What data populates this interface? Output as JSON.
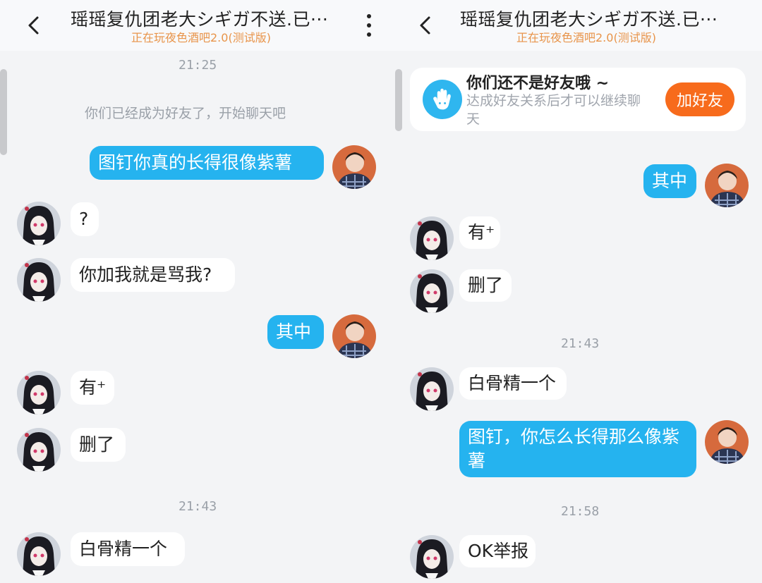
{
  "left": {
    "title": "瑶瑶复仇团老大シギガ不送.已···",
    "subtitle": "正在玩夜色酒吧2.0(测试版)",
    "time1": "21:25",
    "system": "你们已经成为好友了，开始聊天吧",
    "messages": [
      "图钉你真的长得很像紫薯",
      "?",
      "你加我就是骂我?",
      "其中",
      "有⁺",
      "删了",
      "白骨精一个"
    ],
    "time2": "21:43"
  },
  "right": {
    "title": "瑶瑶复仇团老大シギガ不送.已···",
    "subtitle": "正在玩夜色酒吧2.0(测试版)",
    "banner": {
      "title": "你们还不是好友哦 ~",
      "desc": "达成好友关系后才可以继续聊天",
      "button": "加好友"
    },
    "messages": [
      "其中",
      "有⁺",
      "删了",
      "白骨精一个",
      "图钉，你怎么长得那么像紫薯",
      "OK举报"
    ],
    "time1": "21:43",
    "time2": "21:58"
  },
  "colors": {
    "outgoing": "#25b3ef",
    "incoming": "#ffffff",
    "subtitle": "#e8944a",
    "add_button": "#f76b1c"
  },
  "icons": {
    "back": "chevron-left-icon",
    "more": "more-vertical-icon",
    "banner": "hand-wave-icon"
  }
}
